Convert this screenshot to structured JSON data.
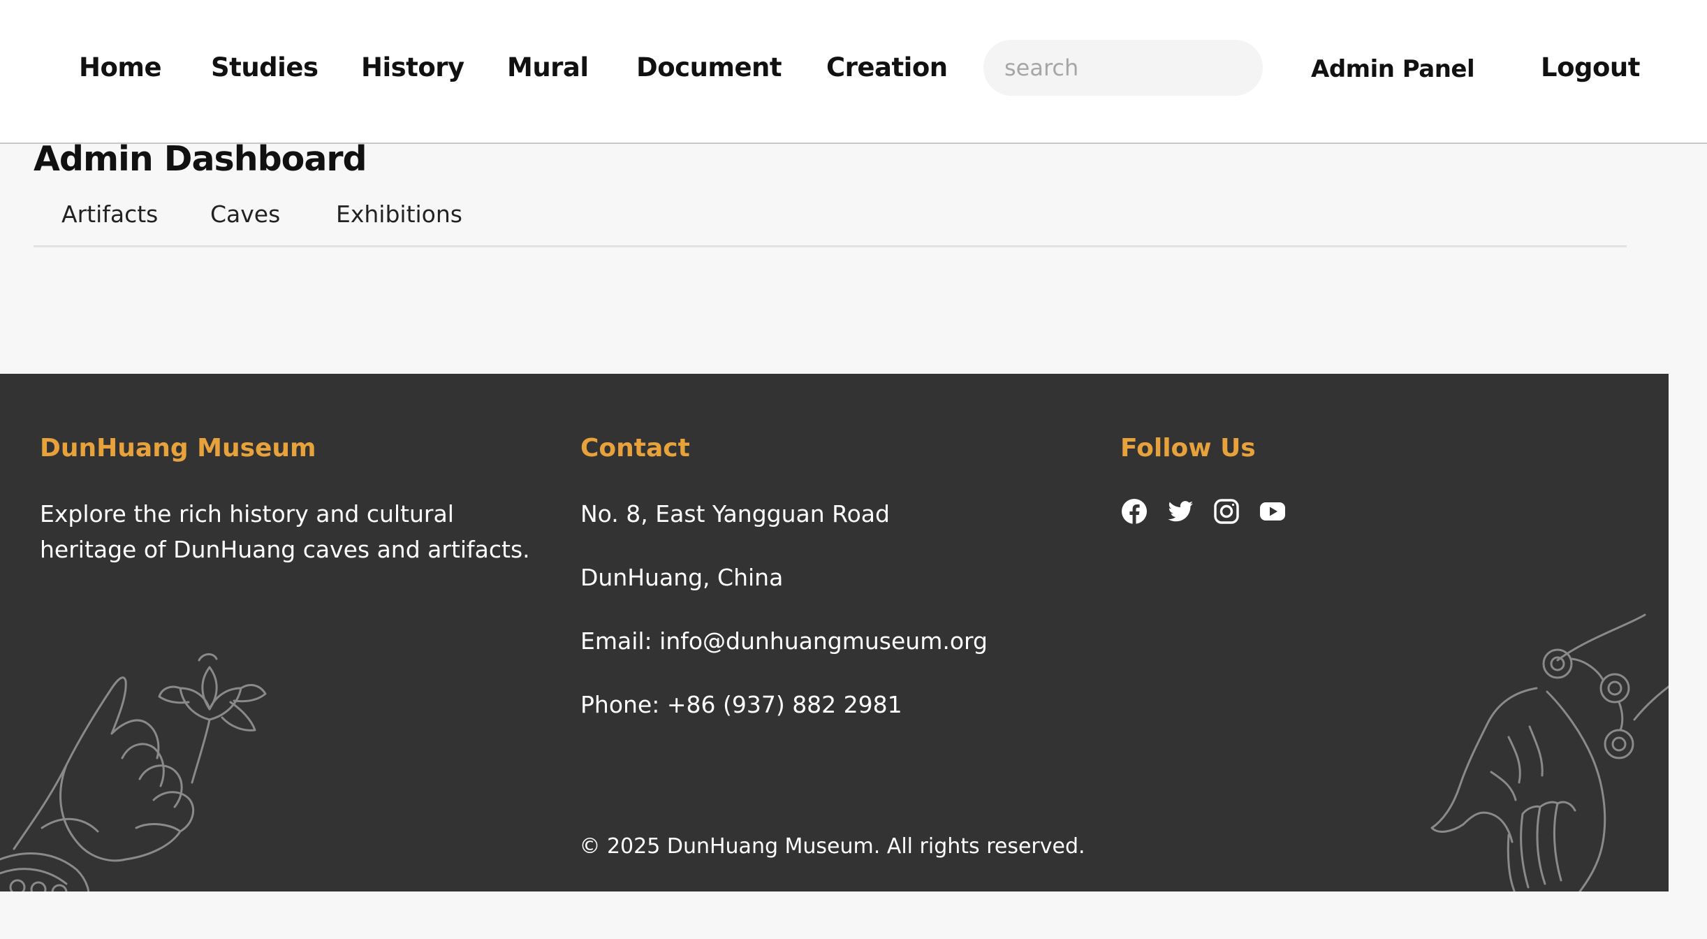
{
  "nav": {
    "items": [
      "Home",
      "Studies",
      "History",
      "Mural",
      "Document",
      "Creation"
    ],
    "search_placeholder": "search",
    "admin_panel": "Admin Panel",
    "logout": "Logout"
  },
  "dashboard": {
    "title": "Admin Dashboard",
    "tabs": [
      "Artifacts",
      "Caves",
      "Exhibitions"
    ]
  },
  "footer": {
    "about": {
      "heading": "DunHuang Museum",
      "text": "Explore the rich history and cultural heritage of DunHuang caves and artifacts."
    },
    "contact": {
      "heading": "Contact",
      "lines": [
        "No. 8, East Yangguan Road",
        "DunHuang, China",
        "Email: info@dunhuangmuseum.org",
        "Phone: +86 (937) 882 2981"
      ]
    },
    "follow": {
      "heading": "Follow Us",
      "icons": [
        "facebook-icon",
        "twitter-icon",
        "instagram-icon",
        "youtube-icon"
      ]
    },
    "copyright": "© 2025 DunHuang Museum. All rights reserved."
  },
  "colors": {
    "accent": "#e8a23c",
    "footer_bg": "#333333",
    "page_bg": "#f7f7f7"
  }
}
